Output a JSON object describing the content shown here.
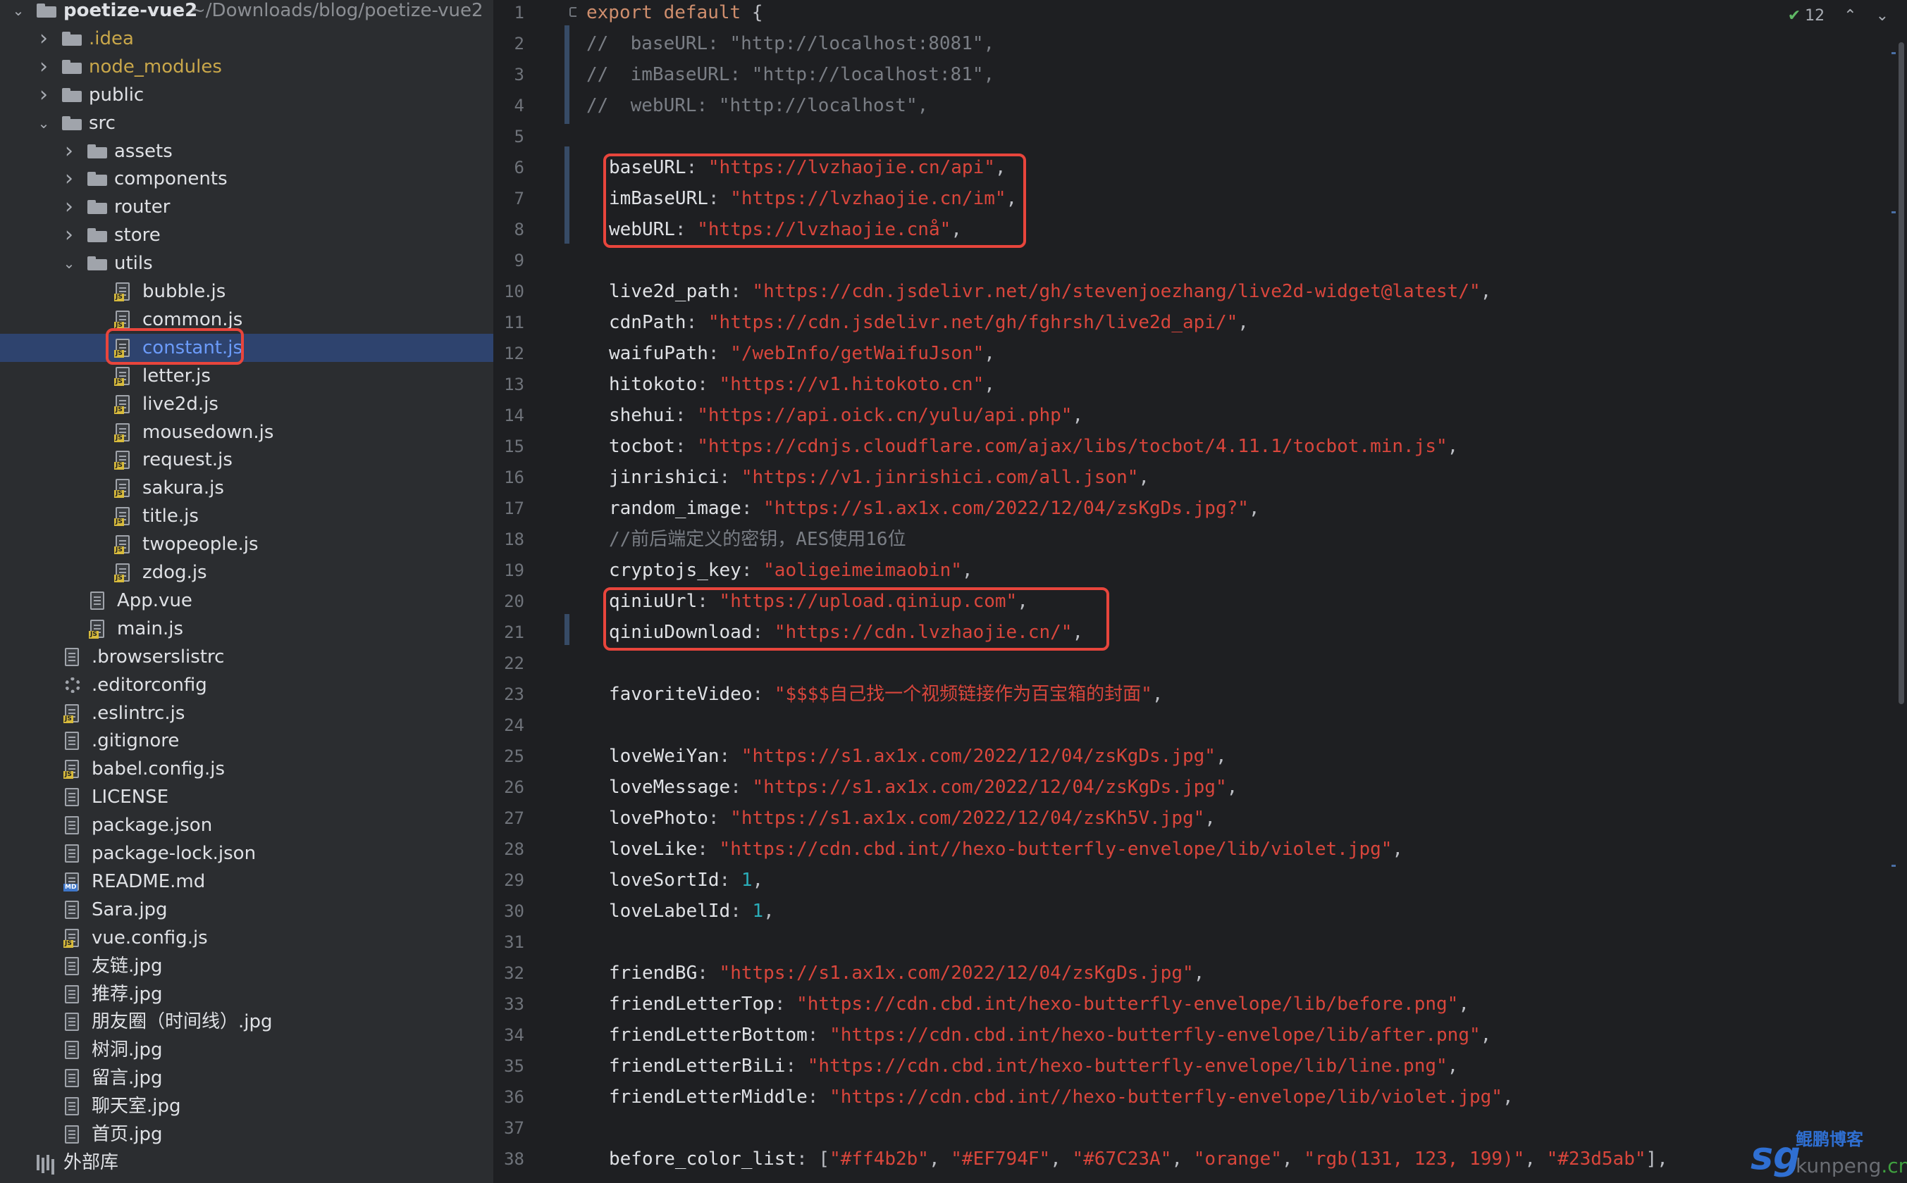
{
  "project": {
    "name": "poetize-vue2",
    "path": "~/Downloads/blog/poetize-vue2"
  },
  "tree": [
    {
      "label": "poetize-vue2",
      "depth": 0,
      "kind": "root",
      "arrow": "open"
    },
    {
      "label": ".idea",
      "depth": 1,
      "kind": "folder",
      "arrow": "closed",
      "color": "yellow"
    },
    {
      "label": "node_modules",
      "depth": 1,
      "kind": "folder",
      "arrow": "closed",
      "color": "yellow"
    },
    {
      "label": "public",
      "depth": 1,
      "kind": "folder",
      "arrow": "closed"
    },
    {
      "label": "src",
      "depth": 1,
      "kind": "folder",
      "arrow": "open"
    },
    {
      "label": "assets",
      "depth": 2,
      "kind": "folder",
      "arrow": "closed"
    },
    {
      "label": "components",
      "depth": 2,
      "kind": "folder",
      "arrow": "closed"
    },
    {
      "label": "router",
      "depth": 2,
      "kind": "folder",
      "arrow": "closed"
    },
    {
      "label": "store",
      "depth": 2,
      "kind": "folder",
      "arrow": "closed"
    },
    {
      "label": "utils",
      "depth": 2,
      "kind": "folder",
      "arrow": "open"
    },
    {
      "label": "bubble.js",
      "depth": 3,
      "kind": "js"
    },
    {
      "label": "common.js",
      "depth": 3,
      "kind": "js"
    },
    {
      "label": "constant.js",
      "depth": 3,
      "kind": "js",
      "selected": true
    },
    {
      "label": "letter.js",
      "depth": 3,
      "kind": "js"
    },
    {
      "label": "live2d.js",
      "depth": 3,
      "kind": "js"
    },
    {
      "label": "mousedown.js",
      "depth": 3,
      "kind": "js"
    },
    {
      "label": "request.js",
      "depth": 3,
      "kind": "js"
    },
    {
      "label": "sakura.js",
      "depth": 3,
      "kind": "js"
    },
    {
      "label": "title.js",
      "depth": 3,
      "kind": "js"
    },
    {
      "label": "twopeople.js",
      "depth": 3,
      "kind": "js"
    },
    {
      "label": "zdog.js",
      "depth": 3,
      "kind": "js"
    },
    {
      "label": "App.vue",
      "depth": 2,
      "kind": "file"
    },
    {
      "label": "main.js",
      "depth": 2,
      "kind": "js"
    },
    {
      "label": ".browserslistrc",
      "depth": 1,
      "kind": "file"
    },
    {
      "label": ".editorconfig",
      "depth": 1,
      "kind": "gear"
    },
    {
      "label": ".eslintrc.js",
      "depth": 1,
      "kind": "js"
    },
    {
      "label": ".gitignore",
      "depth": 1,
      "kind": "file"
    },
    {
      "label": "babel.config.js",
      "depth": 1,
      "kind": "js"
    },
    {
      "label": "LICENSE",
      "depth": 1,
      "kind": "file"
    },
    {
      "label": "package.json",
      "depth": 1,
      "kind": "file"
    },
    {
      "label": "package-lock.json",
      "depth": 1,
      "kind": "file"
    },
    {
      "label": "README.md",
      "depth": 1,
      "kind": "md"
    },
    {
      "label": "Sara.jpg",
      "depth": 1,
      "kind": "file"
    },
    {
      "label": "vue.config.js",
      "depth": 1,
      "kind": "js"
    },
    {
      "label": "友链.jpg",
      "depth": 1,
      "kind": "file"
    },
    {
      "label": "推荐.jpg",
      "depth": 1,
      "kind": "file"
    },
    {
      "label": "朋友圈（时间线）.jpg",
      "depth": 1,
      "kind": "file"
    },
    {
      "label": "树洞.jpg",
      "depth": 1,
      "kind": "file"
    },
    {
      "label": "留言.jpg",
      "depth": 1,
      "kind": "file"
    },
    {
      "label": "聊天室.jpg",
      "depth": 1,
      "kind": "file"
    },
    {
      "label": "首页.jpg",
      "depth": 1,
      "kind": "file"
    },
    {
      "label": "外部库",
      "depth": 0,
      "kind": "lib"
    }
  ],
  "editor": {
    "inspection_count": "12",
    "icons": {
      "check": "checkmark-icon",
      "up": "chevron-up-icon",
      "down": "chevron-down-icon"
    },
    "lines": [
      [
        [
          "kw",
          "export "
        ],
        [
          "kw",
          "default "
        ],
        [
          "punc",
          "{"
        ]
      ],
      [
        [
          "cmt",
          "//  baseURL: \"http://localhost:8081\","
        ]
      ],
      [
        [
          "cmt",
          "//  imBaseURL: \"http://localhost:81\","
        ]
      ],
      [
        [
          "cmt",
          "//  webURL: \"http://localhost\","
        ]
      ],
      [],
      [
        [
          "key",
          "baseURL"
        ],
        [
          "punc",
          ": "
        ],
        [
          "str",
          "\"https://lvzhaojie.cn/api\""
        ],
        [
          "punc",
          ","
        ]
      ],
      [
        [
          "key",
          "imBaseURL"
        ],
        [
          "punc",
          ": "
        ],
        [
          "str",
          "\"https://lvzhaojie.cn/im\""
        ],
        [
          "punc",
          ","
        ]
      ],
      [
        [
          "key",
          "webURL"
        ],
        [
          "punc",
          ": "
        ],
        [
          "str",
          "\"https://lvzhaojie.cnå\""
        ],
        [
          "punc",
          ","
        ]
      ],
      [],
      [
        [
          "key",
          "live2d_path"
        ],
        [
          "punc",
          ": "
        ],
        [
          "str",
          "\"https://cdn.jsdelivr.net/gh/stevenjoezhang/live2d-widget@latest/\""
        ],
        [
          "punc",
          ","
        ]
      ],
      [
        [
          "key",
          "cdnPath"
        ],
        [
          "punc",
          ": "
        ],
        [
          "str",
          "\"https://cdn.jsdelivr.net/gh/fghrsh/live2d_api/\""
        ],
        [
          "punc",
          ","
        ]
      ],
      [
        [
          "key",
          "waifuPath"
        ],
        [
          "punc",
          ": "
        ],
        [
          "str",
          "\"/webInfo/getWaifuJson\""
        ],
        [
          "punc",
          ","
        ]
      ],
      [
        [
          "key",
          "hitokoto"
        ],
        [
          "punc",
          ": "
        ],
        [
          "str",
          "\"https://v1.hitokoto.cn\""
        ],
        [
          "punc",
          ","
        ]
      ],
      [
        [
          "key",
          "shehui"
        ],
        [
          "punc",
          ": "
        ],
        [
          "str",
          "\"https://api.oick.cn/yulu/api.php\""
        ],
        [
          "punc",
          ","
        ]
      ],
      [
        [
          "key",
          "tocbot"
        ],
        [
          "punc",
          ": "
        ],
        [
          "str",
          "\"https://cdnjs.cloudflare.com/ajax/libs/tocbot/4.11.1/tocbot.min.js\""
        ],
        [
          "punc",
          ","
        ]
      ],
      [
        [
          "key",
          "jinrishici"
        ],
        [
          "punc",
          ": "
        ],
        [
          "str",
          "\"https://v1.jinrishici.com/all.json\""
        ],
        [
          "punc",
          ","
        ]
      ],
      [
        [
          "key",
          "random_image"
        ],
        [
          "punc",
          ": "
        ],
        [
          "str",
          "\"https://s1.ax1x.com/2022/12/04/zsKgDs.jpg?\""
        ],
        [
          "punc",
          ","
        ]
      ],
      [
        [
          "cmt",
          "//前后端定义的密钥，AES使用16位"
        ]
      ],
      [
        [
          "key",
          "cryptojs_key"
        ],
        [
          "punc",
          ": "
        ],
        [
          "str",
          "\"aoligeimeimaobin\""
        ],
        [
          "punc",
          ","
        ]
      ],
      [
        [
          "key",
          "qiniuUrl"
        ],
        [
          "punc",
          ": "
        ],
        [
          "str",
          "\"https://upload.qiniup.com\""
        ],
        [
          "punc",
          ","
        ]
      ],
      [
        [
          "key",
          "qiniuDownload"
        ],
        [
          "punc",
          ": "
        ],
        [
          "str",
          "\"https://cdn.lvzhaojie.cn/\""
        ],
        [
          "punc",
          ","
        ]
      ],
      [],
      [
        [
          "key",
          "favoriteVideo"
        ],
        [
          "punc",
          ": "
        ],
        [
          "str",
          "\"$$$$自己找一个视频链接作为百宝箱的封面\""
        ],
        [
          "punc",
          ","
        ]
      ],
      [],
      [
        [
          "key",
          "loveWeiYan"
        ],
        [
          "punc",
          ": "
        ],
        [
          "str",
          "\"https://s1.ax1x.com/2022/12/04/zsKgDs.jpg\""
        ],
        [
          "punc",
          ","
        ]
      ],
      [
        [
          "key",
          "loveMessage"
        ],
        [
          "punc",
          ": "
        ],
        [
          "str",
          "\"https://s1.ax1x.com/2022/12/04/zsKgDs.jpg\""
        ],
        [
          "punc",
          ","
        ]
      ],
      [
        [
          "key",
          "lovePhoto"
        ],
        [
          "punc",
          ": "
        ],
        [
          "str",
          "\"https://s1.ax1x.com/2022/12/04/zsKh5V.jpg\""
        ],
        [
          "punc",
          ","
        ]
      ],
      [
        [
          "key",
          "loveLike"
        ],
        [
          "punc",
          ": "
        ],
        [
          "str",
          "\"https://cdn.cbd.int//hexo-butterfly-envelope/lib/violet.jpg\""
        ],
        [
          "punc",
          ","
        ]
      ],
      [
        [
          "key",
          "loveSortId"
        ],
        [
          "punc",
          ": "
        ],
        [
          "num",
          "1"
        ],
        [
          "punc",
          ","
        ]
      ],
      [
        [
          "key",
          "loveLabelId"
        ],
        [
          "punc",
          ": "
        ],
        [
          "num",
          "1"
        ],
        [
          "punc",
          ","
        ]
      ],
      [],
      [
        [
          "key",
          "friendBG"
        ],
        [
          "punc",
          ": "
        ],
        [
          "str",
          "\"https://s1.ax1x.com/2022/12/04/zsKgDs.jpg\""
        ],
        [
          "punc",
          ","
        ]
      ],
      [
        [
          "key",
          "friendLetterTop"
        ],
        [
          "punc",
          ": "
        ],
        [
          "str",
          "\"https://cdn.cbd.int/hexo-butterfly-envelope/lib/before.png\""
        ],
        [
          "punc",
          ","
        ]
      ],
      [
        [
          "key",
          "friendLetterBottom"
        ],
        [
          "punc",
          ": "
        ],
        [
          "str",
          "\"https://cdn.cbd.int/hexo-butterfly-envelope/lib/after.png\""
        ],
        [
          "punc",
          ","
        ]
      ],
      [
        [
          "key",
          "friendLetterBiLi"
        ],
        [
          "punc",
          ": "
        ],
        [
          "str",
          "\"https://cdn.cbd.int/hexo-butterfly-envelope/lib/line.png\""
        ],
        [
          "punc",
          ","
        ]
      ],
      [
        [
          "key",
          "friendLetterMiddle"
        ],
        [
          "punc",
          ": "
        ],
        [
          "str",
          "\"https://cdn.cbd.int//hexo-butterfly-envelope/lib/violet.jpg\""
        ],
        [
          "punc",
          ","
        ]
      ],
      [],
      [
        [
          "key",
          "before_color_list"
        ],
        [
          "punc",
          ": ["
        ],
        [
          "str",
          "\"#ff4b2b\""
        ],
        [
          "punc",
          ", "
        ],
        [
          "str",
          "\"#EF794F\""
        ],
        [
          "punc",
          ", "
        ],
        [
          "str",
          "\"#67C23A\""
        ],
        [
          "punc",
          ", "
        ],
        [
          "str",
          "\"orange\""
        ],
        [
          "punc",
          ", "
        ],
        [
          "str",
          "\"rgb(131, 123, 199)\""
        ],
        [
          "punc",
          ", "
        ],
        [
          "str",
          "\"#23d5ab\""
        ],
        [
          "punc",
          "],"
        ]
      ]
    ]
  },
  "watermark": {
    "logo": "sg",
    "name": "鲲鹏博客",
    "domain_main": "kunpeng",
    "domain_tld": ".cn"
  },
  "colors": {
    "highlight_box": "#e8453c",
    "string": "#d9463c",
    "keyword": "#cf8e6d",
    "selection": "#2e436e"
  }
}
